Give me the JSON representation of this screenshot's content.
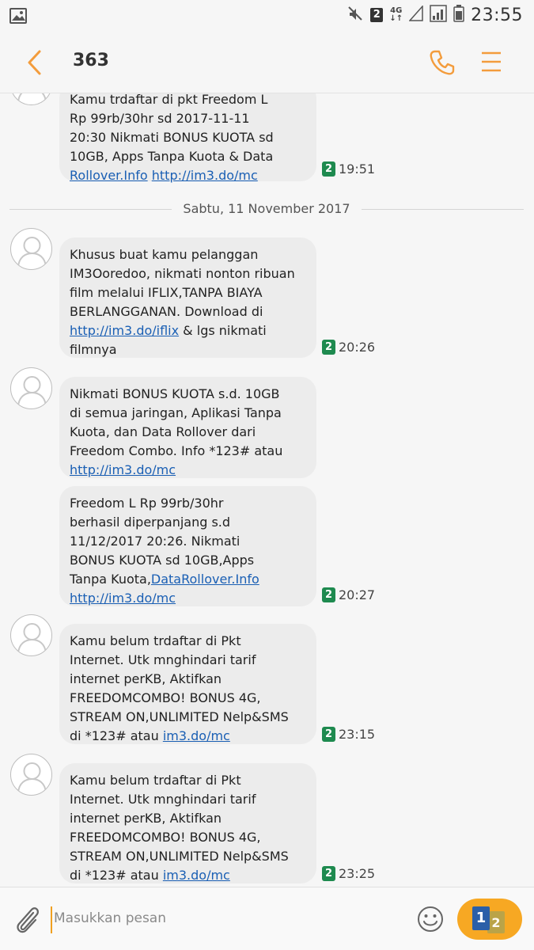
{
  "status_bar": {
    "sim_number": "2",
    "network": "4G",
    "time": "23:55"
  },
  "header": {
    "contact": "363",
    "icons": [
      "back-icon",
      "phone-icon",
      "menu-icon"
    ]
  },
  "date_separator": "Sabtu, 11 November 2017",
  "messages": [
    {
      "text_before": "Kamu trdaftar di pkt Freedom L\nRp 99rb/30hr sd 2017-11-11\n20:30 Nikmati BONUS KUOTA sd\n10GB, Apps Tanpa Kuota & Data\n",
      "link1": "Rollover.Info",
      "link2": "http://im3.do/mc",
      "sim": "2",
      "time": "19:51"
    },
    {
      "text_before": "Khusus buat kamu pelanggan\nIM3Ooredoo, nikmati nonton ribuan\nfilm melalui IFLIX,TANPA BIAYA\nBERLANGGANAN. Download di\n",
      "link": "http://im3.do/iflix",
      "text_after": " & lgs nikmati\nfilmnya",
      "sim": "2",
      "time": "20:26"
    },
    {
      "text_before": "Nikmati BONUS KUOTA s.d. 10GB\ndi semua jaringan, Aplikasi Tanpa\nKuota, dan Data Rollover dari\nFreedom Combo. Info *123# atau\n",
      "link": "http://im3.do/mc"
    },
    {
      "text_before": "Freedom L Rp 99rb/30hr\nberhasil diperpanjang s.d\n11/12/2017 20:26. Nikmati\nBONUS KUOTA sd 10GB,Apps\nTanpa Kuota,",
      "link1": "DataRollover.Info",
      "link2": "http://im3.do/mc",
      "sim": "2",
      "time": "20:27"
    },
    {
      "text_before": "Kamu belum trdaftar di Pkt\nInternet. Utk mnghindari tarif\ninternet perKB, Aktifkan\nFREEDOMCOMBO! BONUS 4G,\nSTREAM ON,UNLIMITED Nelp&SMS\ndi *123# atau ",
      "link": "im3.do/mc",
      "sim": "2",
      "time": "23:15"
    },
    {
      "text_before": "Kamu belum trdaftar di Pkt\nInternet. Utk mnghindari tarif\ninternet perKB, Aktifkan\nFREEDOMCOMBO! BONUS 4G,\nSTREAM ON,UNLIMITED Nelp&SMS\ndi *123# atau ",
      "link": "im3.do/mc",
      "sim": "2",
      "time": "23:25"
    }
  ],
  "compose": {
    "placeholder": "Masukkan pesan",
    "send_sim_primary": "1",
    "send_sim_secondary": "2"
  },
  "colors": {
    "accent": "#f39c3c",
    "sim_badge": "#1e8a4f",
    "link": "#1a5fb4",
    "send_button": "#f7a823"
  }
}
